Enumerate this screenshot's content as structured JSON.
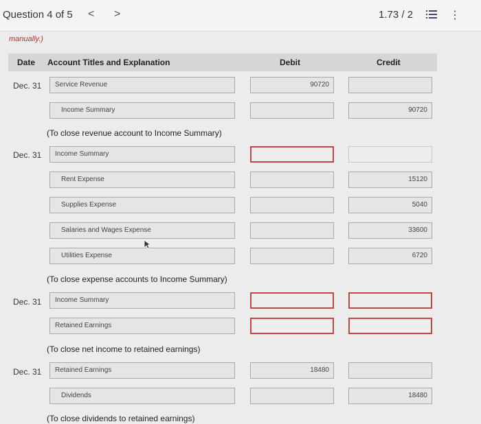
{
  "header": {
    "question_label": "Question 4 of 5",
    "prev_glyph": "<",
    "next_glyph": ">",
    "score": "1.73 / 2",
    "more_glyph": "⋮"
  },
  "instruction_fragment": "manually.)",
  "table": {
    "col_date": "Date",
    "col_account": "Account Titles and Explanation",
    "col_debit": "Debit",
    "col_credit": "Credit"
  },
  "entries": {
    "e1": {
      "date": "Dec. 31",
      "row1": {
        "account": "Service Revenue",
        "debit": "90720",
        "credit": ""
      },
      "row2": {
        "account": "Income Summary",
        "debit": "",
        "credit": "90720"
      },
      "note": "(To close revenue account to Income Summary)"
    },
    "e2": {
      "date": "Dec. 31",
      "row1": {
        "account": "Income Summary",
        "debit": "",
        "credit": ""
      },
      "row2": {
        "account": "Rent Expense",
        "debit": "",
        "credit": "15120"
      },
      "row3": {
        "account": "Supplies Expense",
        "debit": "",
        "credit": "5040"
      },
      "row4": {
        "account": "Salaries and Wages Expense",
        "debit": "",
        "credit": "33600"
      },
      "row5": {
        "account": "Utilities Expense",
        "debit": "",
        "credit": "6720"
      },
      "note": "(To close expense accounts to Income Summary)"
    },
    "e3": {
      "date": "Dec. 31",
      "row1": {
        "account": "Income Summary",
        "debit": "",
        "credit": ""
      },
      "row2": {
        "account": "Retained Earnings",
        "debit": "",
        "credit": ""
      },
      "note": "(To close net income to retained earnings)"
    },
    "e4": {
      "date": "Dec. 31",
      "row1": {
        "account": "Retained Earnings",
        "debit": "18480",
        "credit": ""
      },
      "row2": {
        "account": "Dividends",
        "debit": "",
        "credit": "18480"
      },
      "note": "(To close dividends to retained earnings)"
    }
  },
  "colors": {
    "error_border": "#c04646",
    "instruction": "#b0332f",
    "header_bg": "#d6d6d6"
  }
}
